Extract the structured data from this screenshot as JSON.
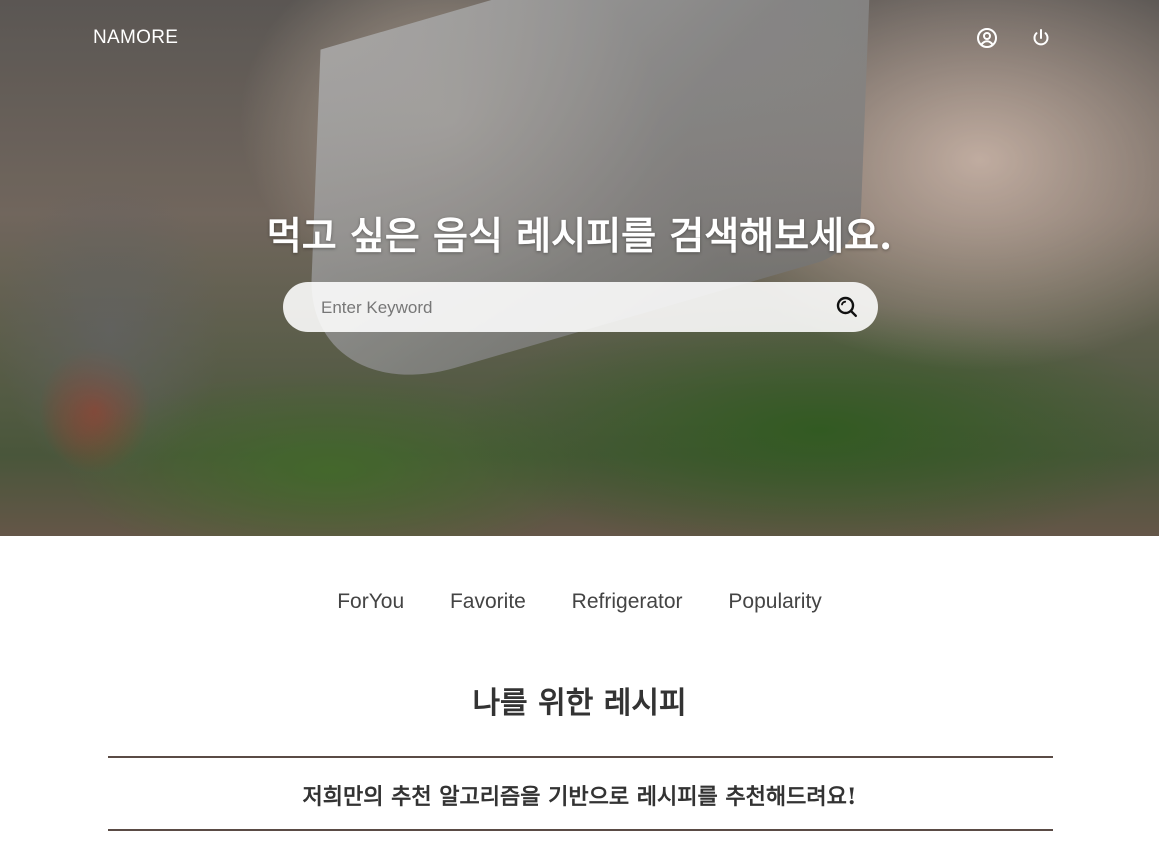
{
  "header": {
    "brand": "NAMORE",
    "icons": [
      "user-circle-icon",
      "power-icon"
    ]
  },
  "hero": {
    "title": "먹고 싶은 음식 레시피를 검색해보세요.",
    "search": {
      "placeholder": "Enter Keyword",
      "value": ""
    }
  },
  "tabs": [
    {
      "label": "ForYou"
    },
    {
      "label": "Favorite"
    },
    {
      "label": "Refrigerator"
    },
    {
      "label": "Popularity"
    }
  ],
  "section": {
    "title": "나를 위한 레시피",
    "subtitle": "저희만의 추천 알고리즘을 기반으로 레시피를 추천해드려요!"
  },
  "colors": {
    "divider": "#5a4b45",
    "text": "#333333"
  }
}
